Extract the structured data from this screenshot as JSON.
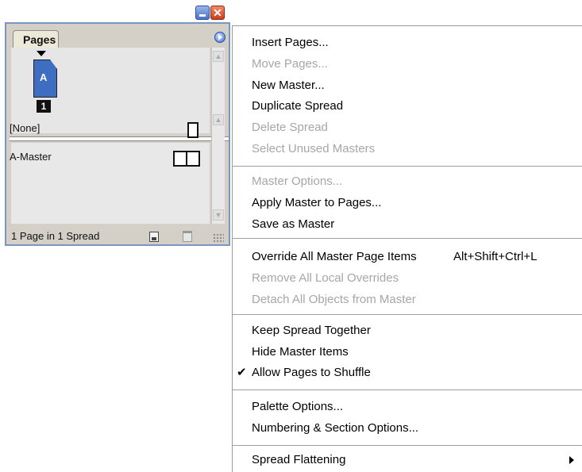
{
  "palette": {
    "tab_label": "Pages",
    "page_thumb_label": "A",
    "page_number": "1",
    "masters": [
      "[None]",
      "A-Master"
    ],
    "status": "1 Page in 1 Spread"
  },
  "menu": {
    "items": [
      {
        "label": "Insert Pages...",
        "enabled": true
      },
      {
        "label": "Move Pages...",
        "enabled": false
      },
      {
        "label": "New Master...",
        "enabled": true
      },
      {
        "label": "Duplicate Spread",
        "enabled": true
      },
      {
        "label": "Delete Spread",
        "enabled": false
      },
      {
        "label": "Select Unused Masters",
        "enabled": false
      },
      {
        "label": "Master Options...",
        "enabled": false
      },
      {
        "label": "Apply Master to Pages...",
        "enabled": true
      },
      {
        "label": "Save as Master",
        "enabled": true
      },
      {
        "label": "Override All Master Page Items",
        "enabled": true,
        "shortcut": "Alt+Shift+Ctrl+L"
      },
      {
        "label": "Remove All Local Overrides",
        "enabled": false
      },
      {
        "label": "Detach All Objects from Master",
        "enabled": false
      },
      {
        "label": "Keep Spread Together",
        "enabled": true
      },
      {
        "label": "Hide Master Items",
        "enabled": true
      },
      {
        "label": "Allow Pages to Shuffle",
        "enabled": true,
        "checked": true
      },
      {
        "label": "Palette Options...",
        "enabled": true
      },
      {
        "label": "Numbering & Section Options...",
        "enabled": true
      },
      {
        "label": "Spread Flattening",
        "enabled": true,
        "submenu": true
      }
    ],
    "check_glyph": "✔"
  },
  "colors": {
    "disabled_text": "#a6a6a6",
    "page_thumb": "#3e6ec2",
    "close_button": "#c8401e"
  }
}
